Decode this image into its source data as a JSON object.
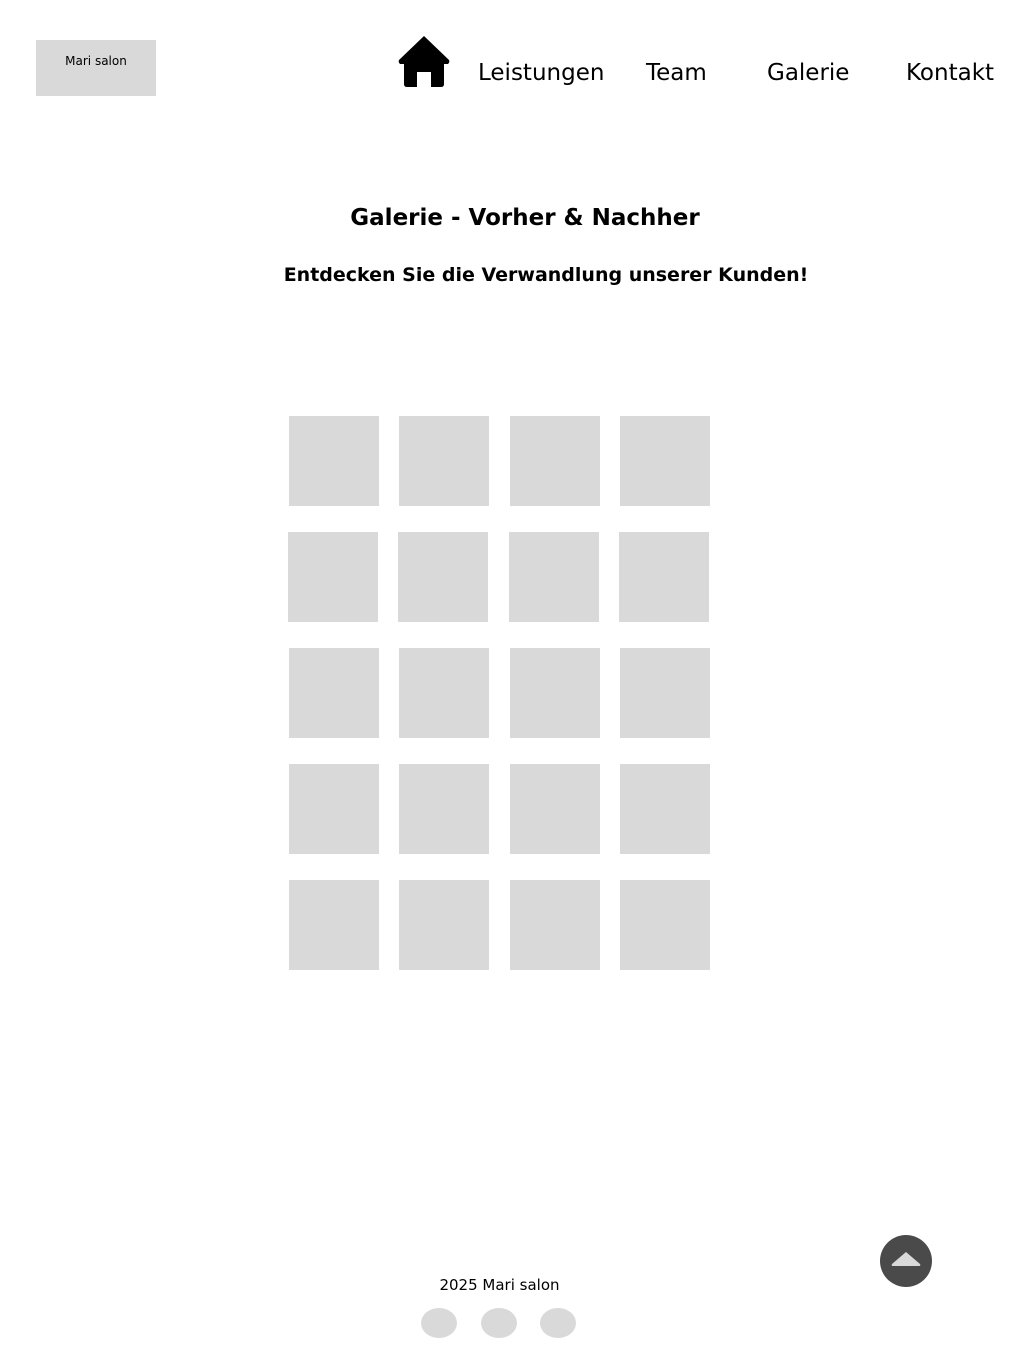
{
  "header": {
    "logo_text": "Mari salon",
    "home_icon": "home-icon",
    "nav": [
      {
        "id": "leistungen",
        "label": "Leistungen"
      },
      {
        "id": "team",
        "label": "Team"
      },
      {
        "id": "galerie",
        "label": "Galerie"
      },
      {
        "id": "kontakt",
        "label": "Kontakt"
      }
    ]
  },
  "main": {
    "title": "Galerie - Vorher & Nachher",
    "subtitle": "Entdecken Sie die Verwandlung unserer Kunden!",
    "gallery": {
      "rows": 5,
      "columns": 4,
      "placeholder_color": "#d9d9d9"
    }
  },
  "scroll_top": {
    "icon": "chevron-up-icon",
    "color": "#4a4a4a"
  },
  "footer": {
    "text": "2025 Mari salon",
    "social_icons": [
      "social-icon-1",
      "social-icon-2",
      "social-icon-3"
    ]
  }
}
